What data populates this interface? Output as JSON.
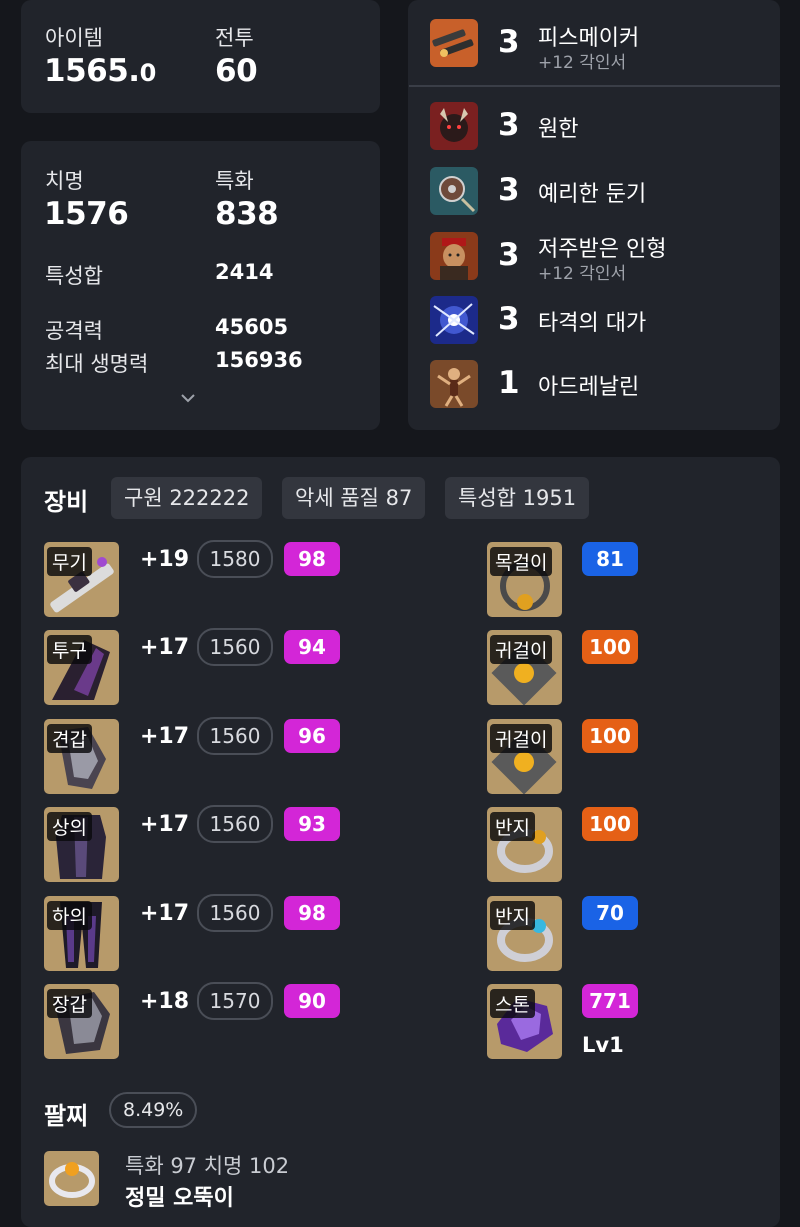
{
  "stats_card": {
    "item_label": "아이템",
    "item_value_main": "1565.",
    "item_value_dec": "0",
    "combat_label": "전투",
    "combat_value": "60"
  },
  "stats_detail": {
    "crit_label": "치명",
    "crit_value": "1576",
    "spec_label": "특화",
    "spec_value": "838",
    "total_label": "특성합",
    "total_value": "2414",
    "atk_label": "공격력",
    "atk_value": "45605",
    "hp_label": "최대 생명력",
    "hp_value": "156936",
    "expand_icon": "chevron-down-icon"
  },
  "engravings": [
    {
      "level": "3",
      "name": "피스메이커",
      "sub": "+12 각인서",
      "icon": "peacemaker-icon"
    },
    {
      "level": "3",
      "name": "원한",
      "sub": "",
      "icon": "grudge-icon"
    },
    {
      "level": "3",
      "name": "예리한 둔기",
      "sub": "",
      "icon": "keen-blunt-weapon-icon"
    },
    {
      "level": "3",
      "name": "저주받은 인형",
      "sub": "+12 각인서",
      "icon": "cursed-doll-icon"
    },
    {
      "level": "3",
      "name": "타격의 대가",
      "sub": "",
      "icon": "hit-master-icon"
    },
    {
      "level": "1",
      "name": "아드레날린",
      "sub": "",
      "icon": "adrenaline-icon"
    }
  ],
  "equipment": {
    "title": "장비",
    "chips": [
      "구원 222222",
      "악세 품질 87",
      "특성합 1951"
    ],
    "gear": [
      {
        "tag": "무기",
        "plus": "+19",
        "level": "1580",
        "quality": "98",
        "quality_color": "#d326d7"
      },
      {
        "tag": "투구",
        "plus": "+17",
        "level": "1560",
        "quality": "94",
        "quality_color": "#d326d7"
      },
      {
        "tag": "견갑",
        "plus": "+17",
        "level": "1560",
        "quality": "96",
        "quality_color": "#d326d7"
      },
      {
        "tag": "상의",
        "plus": "+17",
        "level": "1560",
        "quality": "93",
        "quality_color": "#d326d7"
      },
      {
        "tag": "하의",
        "plus": "+17",
        "level": "1560",
        "quality": "98",
        "quality_color": "#d326d7"
      },
      {
        "tag": "장갑",
        "plus": "+18",
        "level": "1570",
        "quality": "90",
        "quality_color": "#d326d7"
      }
    ],
    "accessories": [
      {
        "tag": "목걸이",
        "quality": "81",
        "quality_color": "#1a63e6"
      },
      {
        "tag": "귀걸이",
        "quality": "100",
        "quality_color": "#e56016"
      },
      {
        "tag": "귀걸이",
        "quality": "100",
        "quality_color": "#e56016"
      },
      {
        "tag": "반지",
        "quality": "100",
        "quality_color": "#e56016"
      },
      {
        "tag": "반지",
        "quality": "70",
        "quality_color": "#1a63e6"
      },
      {
        "tag": "스톤",
        "quality": "771",
        "quality_color": "#d326d7",
        "extra": "Lv1"
      }
    ],
    "bracelet": {
      "title": "팔찌",
      "percent": "8.49%",
      "stats": "특화 97  치명 102",
      "name": "정밀  오뚝이"
    }
  }
}
